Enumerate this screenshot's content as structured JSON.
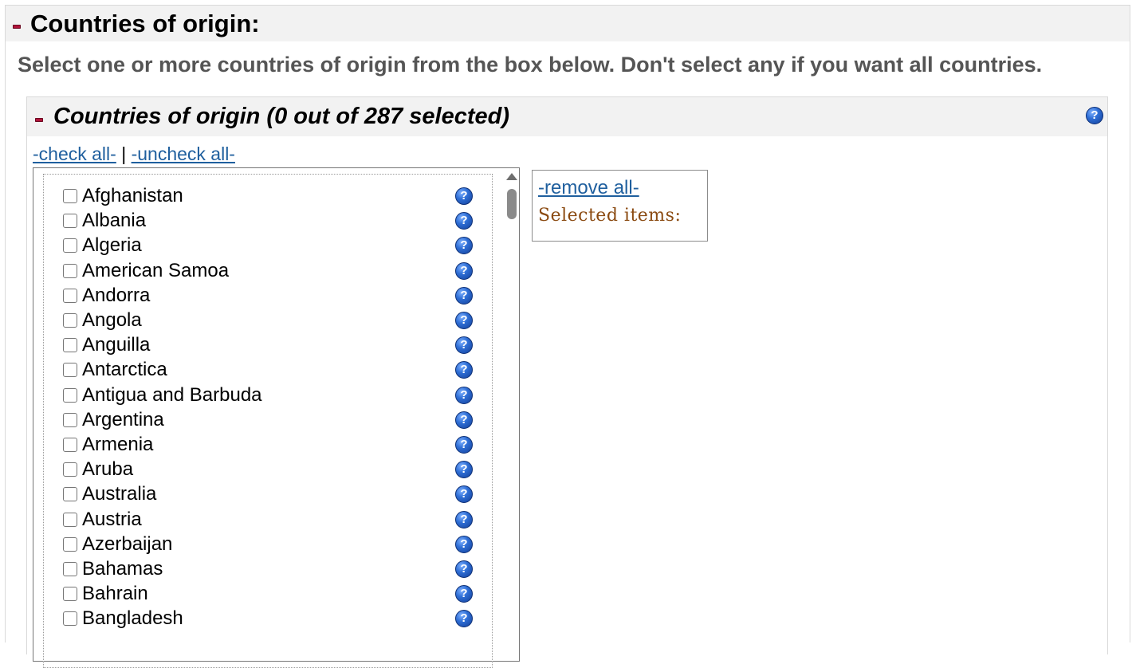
{
  "outer_panel": {
    "title": "Countries of origin:",
    "instructions": "Select one or more countries of origin from the box below. Don't select any if you want all countries."
  },
  "inner_panel": {
    "title": "Countries of origin (0 out of 287 selected)",
    "help_glyph": "?",
    "check_all": "-check all-",
    "separator": "|",
    "uncheck_all": "-uncheck all-"
  },
  "countries": [
    {
      "name": "Afghanistan",
      "checked": false
    },
    {
      "name": "Albania",
      "checked": false
    },
    {
      "name": "Algeria",
      "checked": false
    },
    {
      "name": "American Samoa",
      "checked": false
    },
    {
      "name": "Andorra",
      "checked": false
    },
    {
      "name": "Angola",
      "checked": false
    },
    {
      "name": "Anguilla",
      "checked": false
    },
    {
      "name": "Antarctica",
      "checked": false
    },
    {
      "name": "Antigua and Barbuda",
      "checked": false
    },
    {
      "name": "Argentina",
      "checked": false
    },
    {
      "name": "Armenia",
      "checked": false
    },
    {
      "name": "Aruba",
      "checked": false
    },
    {
      "name": "Australia",
      "checked": false
    },
    {
      "name": "Austria",
      "checked": false
    },
    {
      "name": "Azerbaijan",
      "checked": false
    },
    {
      "name": "Bahamas",
      "checked": false
    },
    {
      "name": "Bahrain",
      "checked": false
    },
    {
      "name": "Bangladesh",
      "checked": false
    }
  ],
  "selected_panel": {
    "remove_all": "-remove all-",
    "label": "Selected items:"
  },
  "colors": {
    "link": "#1f5f9e",
    "collapse_icon": "#b0133a",
    "selected_label": "#8b4b12",
    "help_icon": "#2f6fd6"
  },
  "icons": {
    "collapse": "minus-collapse-icon",
    "help": "question-help-icon"
  }
}
